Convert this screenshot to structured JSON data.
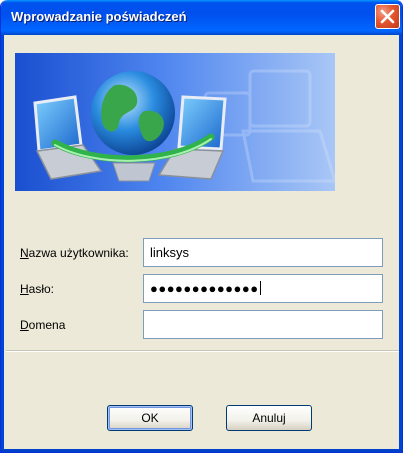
{
  "window": {
    "title": "Wprowadzanie poświadczeń"
  },
  "form": {
    "username": {
      "label_underlined": "N",
      "label_rest": "azwa użytkownika:",
      "value": "linksys"
    },
    "password": {
      "label_underlined": "H",
      "label_rest": "asło:",
      "value": "●●●●●●●●●●●●●"
    },
    "domain": {
      "label_underlined": "D",
      "label_rest": "omena",
      "value": ""
    }
  },
  "buttons": {
    "ok": "OK",
    "cancel": "Anuluj"
  },
  "icons": {
    "close": "close-icon",
    "banner": "network-globe-icon"
  },
  "colors": {
    "titlebar": "#0053ee",
    "close": "#e4572f",
    "dialog_bg": "#ece9d8"
  }
}
